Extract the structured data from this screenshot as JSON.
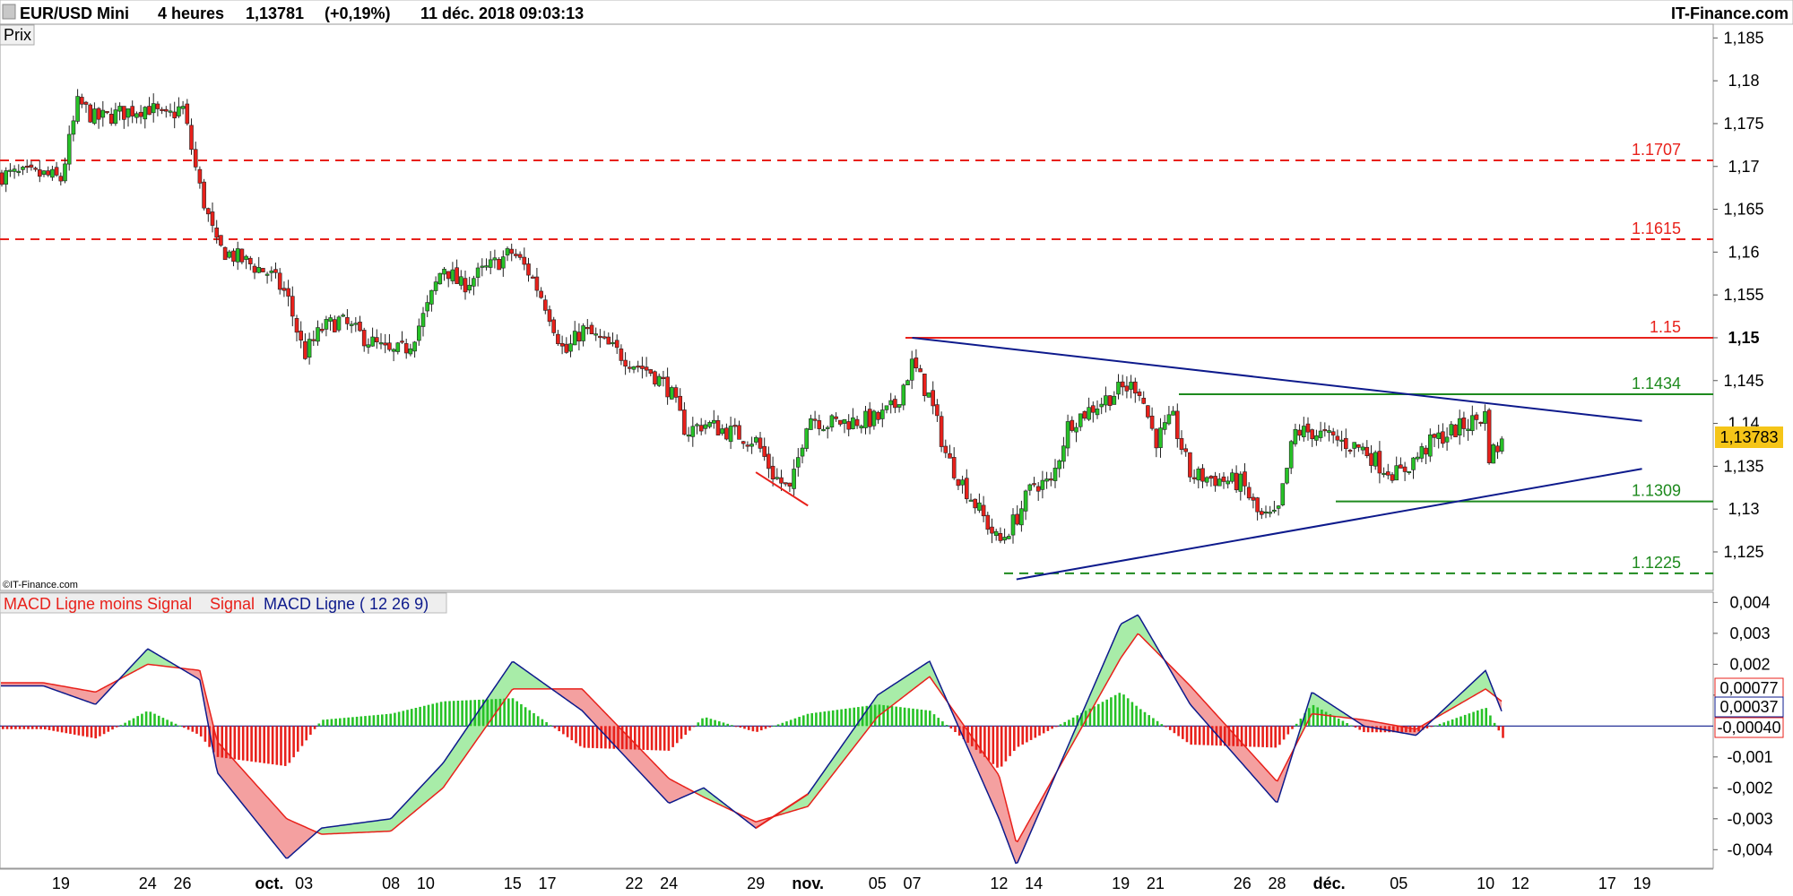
{
  "header": {
    "symbol": "EUR/USD Mini",
    "timeframe": "4 heures",
    "price": "1,13781",
    "change": "(+0,19%)",
    "datetime": "11 déc. 2018 09:03:13",
    "brand": "IT-Finance.com"
  },
  "price_panel": {
    "title": "Prix",
    "watermark": "©IT-Finance.com",
    "current_price_label": "1,13783",
    "levels": [
      {
        "value": 1.1707,
        "label": "1.1707",
        "color": "#e8211b",
        "style": "dashed"
      },
      {
        "value": 1.1615,
        "label": "1.1615",
        "color": "#e8211b",
        "style": "dashed"
      },
      {
        "value": 1.15,
        "label": "1.15",
        "color": "#e8211b",
        "style": "solid"
      },
      {
        "value": 1.1434,
        "label": "1.1434",
        "color": "#1e8a1e",
        "style": "solid"
      },
      {
        "value": 1.1309,
        "label": "1.1309",
        "color": "#1e8a1e",
        "style": "solid"
      },
      {
        "value": 1.1225,
        "label": "1.1225",
        "color": "#1e8a1e",
        "style": "dashed"
      }
    ]
  },
  "macd_panel": {
    "legend": [
      "MACD Ligne moins Signal",
      "Signal",
      "MACD Ligne ( 12 26 9)"
    ],
    "value_labels": [
      "0,00077",
      "0,00037",
      "-0,00040"
    ]
  },
  "colors": {
    "up": "#27c227",
    "down": "#e8211b",
    "trend": "#0d1a8c",
    "signal_fill": "#f4a0a0",
    "macd_fill": "#a8eca8",
    "highlight": "#f5c518"
  },
  "chart_data": [
    {
      "type": "candlestick",
      "title": "EUR/USD Mini 4 heures",
      "ylabel": "Prix",
      "ylim": [
        1.1205,
        1.1865
      ],
      "y_ticks": [
        "1,185",
        "1,18",
        "1,175",
        "1,17",
        "1,165",
        "1,16",
        "1,155",
        "1,15",
        "1,145",
        "1,14",
        "1,135",
        "1,13",
        "1,125"
      ],
      "x_ticks": [
        "19",
        "24",
        "26",
        "oct.",
        "03",
        "08",
        "10",
        "15",
        "17",
        "22",
        "24",
        "29",
        "nov.",
        "05",
        "07",
        "12",
        "14",
        "19",
        "21",
        "26",
        "28",
        "déc.",
        "05",
        "10",
        "12",
        "17",
        "19"
      ],
      "x": [],
      "close_path": [
        [
          "2018-09-18",
          1.169
        ],
        [
          "2018-09-19",
          1.1685
        ],
        [
          "2018-09-20",
          1.1775
        ],
        [
          "2018-09-21",
          1.1755
        ],
        [
          "2018-09-24",
          1.177
        ],
        [
          "2018-09-25",
          1.1755
        ],
        [
          "2018-09-26",
          1.177
        ],
        [
          "2018-09-27",
          1.1675
        ],
        [
          "2018-09-28",
          1.1605
        ],
        [
          "2018-10-01",
          1.1575
        ],
        [
          "2018-10-02",
          1.155
        ],
        [
          "2018-10-03",
          1.148
        ],
        [
          "2018-10-04",
          1.151
        ],
        [
          "2018-10-05",
          1.152
        ],
        [
          "2018-10-08",
          1.148
        ],
        [
          "2018-10-09",
          1.149
        ],
        [
          "2018-10-10",
          1.153
        ],
        [
          "2018-10-11",
          1.1585
        ],
        [
          "2018-10-12",
          1.156
        ],
        [
          "2018-10-15",
          1.16
        ],
        [
          "2018-10-16",
          1.1575
        ],
        [
          "2018-10-17",
          1.1535
        ],
        [
          "2018-10-18",
          1.148
        ],
        [
          "2018-10-19",
          1.151
        ],
        [
          "2018-10-22",
          1.147
        ],
        [
          "2018-10-23",
          1.146
        ],
        [
          "2018-10-24",
          1.144
        ],
        [
          "2018-10-25",
          1.139
        ],
        [
          "2018-10-26",
          1.14
        ],
        [
          "2018-10-29",
          1.138
        ],
        [
          "2018-10-30",
          1.134
        ],
        [
          "2018-10-31",
          1.132
        ],
        [
          "2018-11-01",
          1.141
        ],
        [
          "2018-11-02",
          1.14
        ],
        [
          "2018-11-05",
          1.1405
        ],
        [
          "2018-11-06",
          1.142
        ],
        [
          "2018-11-07",
          1.147
        ],
        [
          "2018-11-08",
          1.143
        ],
        [
          "2018-11-09",
          1.136
        ],
        [
          "2018-11-12",
          1.126
        ],
        [
          "2018-11-13",
          1.129
        ],
        [
          "2018-11-14",
          1.133
        ],
        [
          "2018-11-15",
          1.133
        ],
        [
          "2018-11-16",
          1.14
        ],
        [
          "2018-11-19",
          1.144
        ],
        [
          "2018-11-20",
          1.1445
        ],
        [
          "2018-11-21",
          1.138
        ],
        [
          "2018-11-22",
          1.1405
        ],
        [
          "2018-11-23",
          1.134
        ],
        [
          "2018-11-26",
          1.133
        ],
        [
          "2018-11-27",
          1.129
        ],
        [
          "2018-11-28",
          1.129
        ],
        [
          "2018-11-29",
          1.139
        ],
        [
          "2018-11-30",
          1.139
        ],
        [
          "2018-12-03",
          1.137
        ],
        [
          "2018-12-04",
          1.135
        ],
        [
          "2018-12-05",
          1.134
        ],
        [
          "2018-12-06",
          1.136
        ],
        [
          "2018-12-07",
          1.138
        ],
        [
          "2018-12-10",
          1.141
        ],
        [
          "2018-12-10",
          1.136
        ],
        [
          "2018-12-11",
          1.13783
        ]
      ],
      "trend_lines": [
        {
          "from": [
            "2018-11-07",
            1.15
          ],
          "to": [
            "2018-12-19",
            1.1403
          ],
          "color": "#0d1a8c"
        },
        {
          "from": [
            "2018-11-13",
            1.1218
          ],
          "to": [
            "2018-12-19",
            1.1347
          ],
          "color": "#0d1a8c"
        },
        {
          "from": [
            "2018-10-29",
            1.1343
          ],
          "to": [
            "2018-11-01",
            1.1304
          ],
          "color": "#e8211b"
        }
      ]
    },
    {
      "type": "bar",
      "title": "MACD Ligne ( 12 26 9)",
      "ylim": [
        -0.0046,
        0.0043
      ],
      "y_ticks": [
        "0,004",
        "0,003",
        "0,002",
        "0,001",
        "-0,001",
        "-0,002",
        "-0,003",
        "-0,004"
      ],
      "series": [
        {
          "name": "MACD Ligne",
          "path": [
            [
              "2018-09-18",
              0.0013
            ],
            [
              "2018-09-21",
              0.0007
            ],
            [
              "2018-09-24",
              0.0025
            ],
            [
              "2018-09-27",
              0.0015
            ],
            [
              "2018-09-28",
              -0.0015
            ],
            [
              "2018-10-02",
              -0.0043
            ],
            [
              "2018-10-04",
              -0.0033
            ],
            [
              "2018-10-08",
              -0.003
            ],
            [
              "2018-10-11",
              -0.0012
            ],
            [
              "2018-10-15",
              0.0021
            ],
            [
              "2018-10-19",
              0.0005
            ],
            [
              "2018-10-24",
              -0.0025
            ],
            [
              "2018-10-26",
              -0.002
            ],
            [
              "2018-10-29",
              -0.0033
            ],
            [
              "2018-11-01",
              -0.0022
            ],
            [
              "2018-11-05",
              0.001
            ],
            [
              "2018-11-08",
              0.0021
            ],
            [
              "2018-11-12",
              -0.003
            ],
            [
              "2018-11-13",
              -0.0045
            ],
            [
              "2018-11-19",
              0.0033
            ],
            [
              "2018-11-20",
              0.0036
            ],
            [
              "2018-11-23",
              0.0007
            ],
            [
              "2018-11-28",
              -0.0025
            ],
            [
              "2018-11-30",
              0.0011
            ],
            [
              "2018-12-03",
              0.0
            ],
            [
              "2018-12-06",
              -0.0003
            ],
            [
              "2018-12-10",
              0.0018
            ],
            [
              "2018-12-11",
              0.00037
            ]
          ]
        },
        {
          "name": "Signal",
          "path": [
            [
              "2018-09-18",
              0.0014
            ],
            [
              "2018-09-21",
              0.0011
            ],
            [
              "2018-09-24",
              0.002
            ],
            [
              "2018-09-27",
              0.0018
            ],
            [
              "2018-09-28",
              -0.0005
            ],
            [
              "2018-10-02",
              -0.003
            ],
            [
              "2018-10-04",
              -0.0035
            ],
            [
              "2018-10-08",
              -0.0034
            ],
            [
              "2018-10-11",
              -0.002
            ],
            [
              "2018-10-15",
              0.0012
            ],
            [
              "2018-10-19",
              0.0012
            ],
            [
              "2018-10-24",
              -0.0017
            ],
            [
              "2018-10-26",
              -0.0023
            ],
            [
              "2018-10-29",
              -0.0031
            ],
            [
              "2018-11-01",
              -0.0026
            ],
            [
              "2018-11-05",
              0.0003
            ],
            [
              "2018-11-08",
              0.0016
            ],
            [
              "2018-11-12",
              -0.0016
            ],
            [
              "2018-11-13",
              -0.0038
            ],
            [
              "2018-11-19",
              0.0022
            ],
            [
              "2018-11-20",
              0.003
            ],
            [
              "2018-11-23",
              0.0013
            ],
            [
              "2018-11-28",
              -0.0018
            ],
            [
              "2018-11-30",
              0.0004
            ],
            [
              "2018-12-03",
              0.0002
            ],
            [
              "2018-12-06",
              -0.0001
            ],
            [
              "2018-12-10",
              0.0012
            ],
            [
              "2018-12-11",
              0.00077
            ]
          ]
        }
      ],
      "divergence_line": {
        "from": [
          "2018-10-29",
          -0.0033
        ],
        "to": [
          "2018-11-01",
          -0.0022
        ]
      }
    }
  ]
}
